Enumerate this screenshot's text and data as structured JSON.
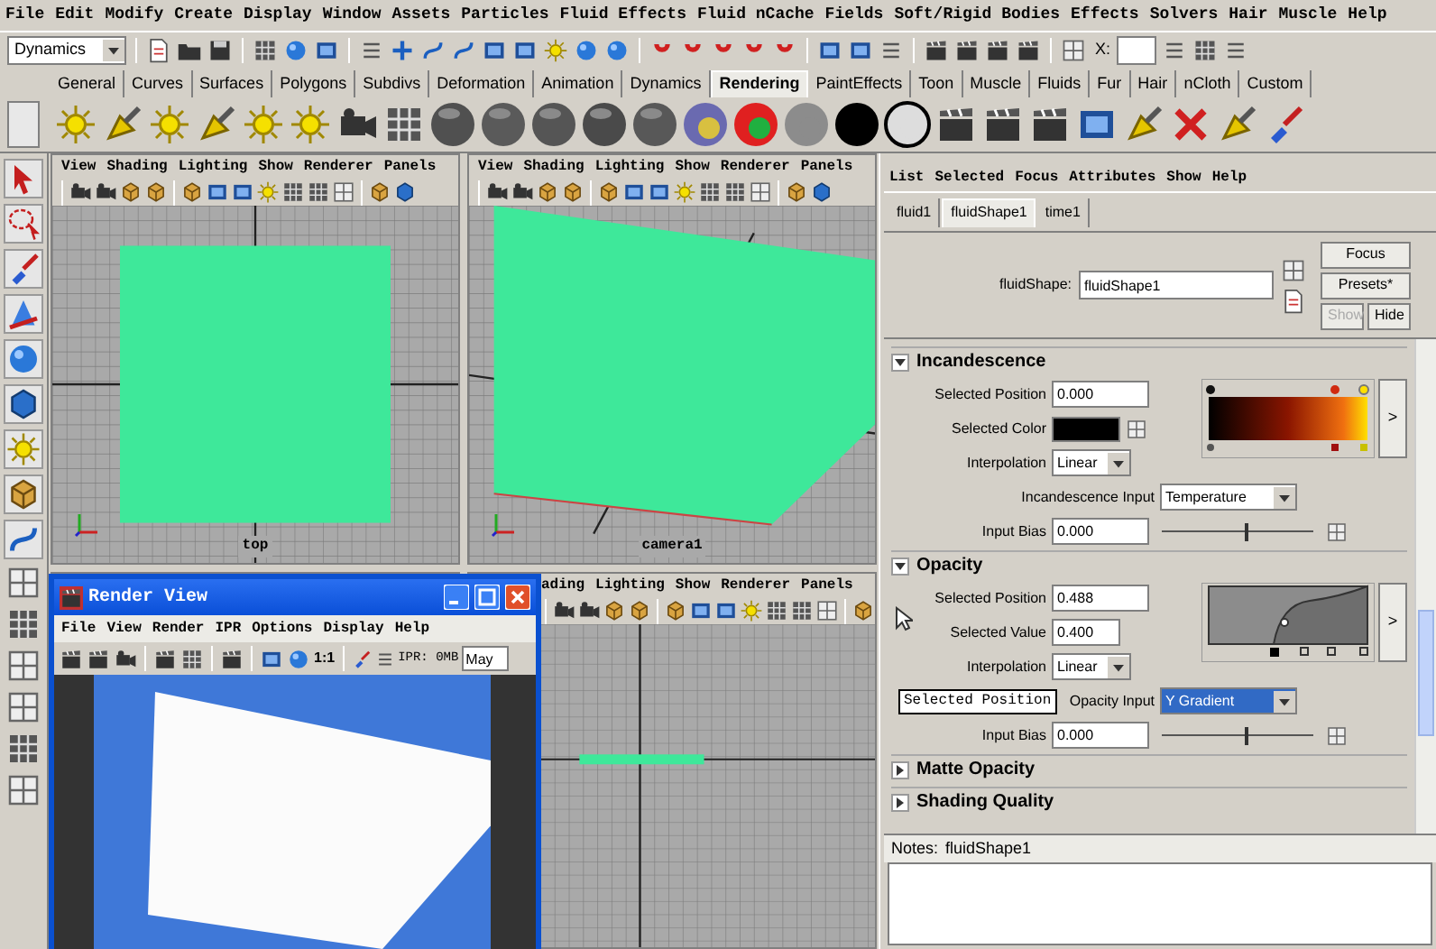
{
  "menu_bar": [
    "File",
    "Edit",
    "Modify",
    "Create",
    "Display",
    "Window",
    "Assets",
    "Particles",
    "Fluid Effects",
    "Fluid nCache",
    "Fields",
    "Soft/Rigid Bodies",
    "Effects",
    "Solvers",
    "Hair",
    "Muscle",
    "Help"
  ],
  "status_line": {
    "menu_set": "Dynamics",
    "x_label": "X:"
  },
  "shelf_tabs": [
    {
      "label": "General",
      "selected": false
    },
    {
      "label": "Curves",
      "selected": false
    },
    {
      "label": "Surfaces",
      "selected": false
    },
    {
      "label": "Polygons",
      "selected": false
    },
    {
      "label": "Subdivs",
      "selected": false
    },
    {
      "label": "Deformation",
      "selected": false
    },
    {
      "label": "Animation",
      "selected": false
    },
    {
      "label": "Dynamics",
      "selected": false
    },
    {
      "label": "Rendering",
      "selected": true
    },
    {
      "label": "PaintEffects",
      "selected": false
    },
    {
      "label": "Toon",
      "selected": false
    },
    {
      "label": "Muscle",
      "selected": false
    },
    {
      "label": "Fluids",
      "selected": false
    },
    {
      "label": "Fur",
      "selected": false
    },
    {
      "label": "Hair",
      "selected": false
    },
    {
      "label": "nCloth",
      "selected": false
    },
    {
      "label": "Custom",
      "selected": false
    }
  ],
  "viewports": [
    {
      "kind": "top",
      "menu": [
        "View",
        "Shading",
        "Lighting",
        "Show",
        "Renderer",
        "Panels"
      ],
      "camera": "top"
    },
    {
      "kind": "perspective",
      "menu": [
        "View",
        "Shading",
        "Lighting",
        "Show",
        "Renderer",
        "Panels"
      ],
      "camera": "camera1"
    },
    {
      "kind": "front",
      "menu": [
        "ading",
        "Lighting",
        "Show",
        "Renderer",
        "Panels"
      ]
    }
  ],
  "render_view": {
    "title": "Render View",
    "menu": [
      "File",
      "View",
      "Render",
      "IPR",
      "Options",
      "Display",
      "Help"
    ],
    "ratio": "1:1",
    "ipr_memory": "IPR: 0MB",
    "camera_field": "May"
  },
  "attribute_editor": {
    "menu": [
      "List",
      "Selected",
      "Focus",
      "Attributes",
      "Show",
      "Help"
    ],
    "tabs": [
      {
        "label": "fluid1",
        "selected": false
      },
      {
        "label": "fluidShape1",
        "selected": true
      },
      {
        "label": "time1",
        "selected": false
      }
    ],
    "node_label": "fluidShape:",
    "node_name": "fluidShape1",
    "buttons": [
      {
        "label": "Focus",
        "disabled": false
      },
      {
        "label": "Presets*",
        "disabled": false
      },
      {
        "label": "Show",
        "disabled": true
      },
      {
        "label": "Hide",
        "disabled": false
      }
    ],
    "sections": [
      {
        "title": "Incandescence",
        "expanded": true,
        "kind": "color_ramp",
        "expand_label": ">",
        "rows": [
          {
            "kind": "field",
            "label": "Selected Position",
            "value": "0.000"
          },
          {
            "kind": "swatch",
            "label": "Selected Color"
          },
          {
            "kind": "dropdown",
            "label": "Interpolation",
            "value": "Linear"
          },
          {
            "kind": "input",
            "label": "Incandescence Input",
            "value": "Temperature",
            "selected": false
          },
          {
            "kind": "slider",
            "label": "Input Bias",
            "value": "0.000",
            "level": 0.55
          }
        ]
      },
      {
        "title": "Opacity",
        "expanded": true,
        "kind": "curve_ramp",
        "expand_label": ">",
        "rows": [
          {
            "kind": "field",
            "label": "Selected Position",
            "value": "0.488"
          },
          {
            "kind": "field_short",
            "label": "Selected Value",
            "value": "0.400"
          },
          {
            "kind": "dropdown",
            "label": "Interpolation",
            "value": "Linear"
          },
          {
            "kind": "input",
            "label": "Opacity Input",
            "value": "Y Gradient",
            "selected": true
          },
          {
            "kind": "slider",
            "label": "Input Bias",
            "value": "0.000",
            "level": 0.55
          }
        ]
      },
      {
        "title": "Matte Opacity",
        "expanded": false
      },
      {
        "title": "Shading Quality",
        "expanded": false
      }
    ],
    "tooltip": "Selected Position",
    "notes": {
      "label": "Notes:",
      "node": "fluidShape1"
    }
  }
}
